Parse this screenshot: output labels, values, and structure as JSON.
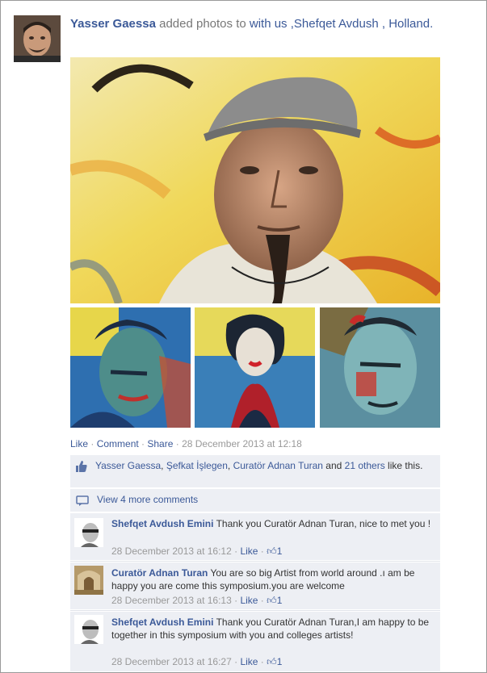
{
  "post": {
    "author": "Yasser Gaessa",
    "verb": " added photos to ",
    "with_text": "with us ,Shefqet Avdush , Holland.",
    "actions": {
      "like": "Like",
      "dot1": " · ",
      "comment": "Comment",
      "dot2": " · ",
      "share": "Share",
      "dot3": " · ",
      "timestamp": "28 December 2013 at 12:18"
    }
  },
  "likes": {
    "names": [
      {
        "text": "Yasser Gaessa",
        "sep": ", "
      },
      {
        "text": "Şefkat İşlegen",
        "sep": ", "
      },
      {
        "text": "Curatör Adnan Turan",
        "sep": " and "
      }
    ],
    "others": "21 others",
    "tail": " like this."
  },
  "view_more": "View 4 more comments",
  "comments": [
    {
      "author": "Shefqet Avdush Emini",
      "text": " Thank you Curatör Adnan Turan, nice to met you !",
      "time": "28 December 2013 at 16:12",
      "like": "Like",
      "likes_count": "1"
    },
    {
      "author": "Curatör Adnan Turan",
      "text": " You are so big Artist from world around .ı am be happy you are come this symposium.you are welcome",
      "time": "28 December 2013 at 16:13",
      "like": "Like",
      "likes_count": "1"
    },
    {
      "author": "Shefqet Avdush Emini",
      "text": " Thank you Curatör Adnan Turan,I am happy to be together in this symposium with you and colleges artists!",
      "time": "28 December 2013 at 16:27",
      "like": "Like",
      "likes_count": "1"
    }
  ],
  "colors": {
    "link": "#3b5998",
    "ufi_bg": "#edeff4",
    "muted": "#999999"
  }
}
